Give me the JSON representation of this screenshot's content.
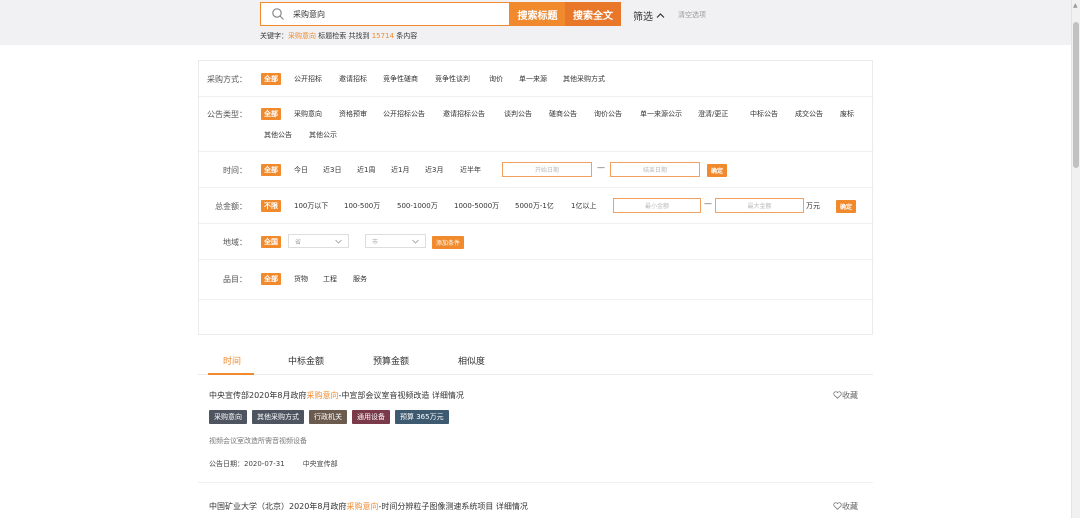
{
  "search": {
    "value": "采购意向",
    "btn_title": "搜索标题",
    "btn_full": "搜索全文",
    "filter_label": "筛选",
    "clear_label": "清空选项",
    "kw_prefix": "关键字：",
    "kw_value": "采购意向",
    "kw_mid": " 标题检索 共找到 ",
    "kw_count": "15714",
    "kw_suffix": " 条内容"
  },
  "filters": {
    "method": {
      "label": "采购方式：",
      "options": [
        "全部",
        "公开招标",
        "邀请招标",
        "竞争性磋商",
        "竞争性谈判",
        "询价",
        "单一来源",
        "其他采购方式"
      ]
    },
    "notice": {
      "label": "公告类型：",
      "options": [
        "全部",
        "采购意向",
        "资格预审",
        "公开招标公告",
        "邀请招标公告",
        "谈判公告",
        "磋商公告",
        "询价公告",
        "单一来源公示",
        "澄清/更正",
        "中标公告",
        "成交公告",
        "废标",
        "其他公告",
        "其他公示"
      ]
    },
    "time": {
      "label": "时间：",
      "options": [
        "全部",
        "今日",
        "近3日",
        "近1周",
        "近1月",
        "近3月",
        "近半年"
      ],
      "start_ph": "开始日期",
      "end_ph": "结束日期",
      "dash": "—",
      "ok": "确定"
    },
    "amount": {
      "label": "总金额：",
      "options": [
        "不限",
        "100万以下",
        "100-500万",
        "500-1000万",
        "1000-5000万",
        "5000万-1亿",
        "1亿以上"
      ],
      "min_ph": "最小金额",
      "max_ph": "最大金额",
      "dash": "—",
      "unit": "万元",
      "ok": "确定"
    },
    "region": {
      "label": "地域：",
      "all": "全国",
      "province_ph": "省",
      "city_ph": "市",
      "add": "添加条件"
    },
    "category": {
      "label": "品目：",
      "options": [
        "全部",
        "货物",
        "工程",
        "服务"
      ]
    }
  },
  "sort_tabs": [
    "时间",
    "中标金额",
    "预算金额",
    "相似度"
  ],
  "results": [
    {
      "title_pre": "中央宣传部2020年8月政府",
      "title_hl": "采购意向",
      "title_post": "-中宣部会议室音视频改造 详细情况",
      "fav": "收藏",
      "tags": [
        {
          "text": "采购意向",
          "color": "#4e5560"
        },
        {
          "text": "其他采购方式",
          "color": "#4e5560"
        },
        {
          "text": "行政机关",
          "color": "#6b5b4e"
        },
        {
          "text": "通用设备",
          "color": "#7a3a4a"
        },
        {
          "text": "预算 365万元",
          "color": "#3e5a70"
        }
      ],
      "desc": "视频会议室改造所需音视频设备",
      "date_label": "公告日期：",
      "date": "2020-07-31",
      "org": "中央宣传部"
    },
    {
      "title_pre": "中国矿业大学（北京）2020年8月政府",
      "title_hl": "采购意向",
      "title_post": "-时间分辨粒子图像测速系统项目 详细情况",
      "fav": "收藏"
    }
  ],
  "colors": {
    "accent": "#f08a2c",
    "accent_dark": "#e8772a"
  },
  "icons": {
    "search": "search-icon",
    "chevron": "chevron-up-icon",
    "heart": "heart-icon"
  }
}
